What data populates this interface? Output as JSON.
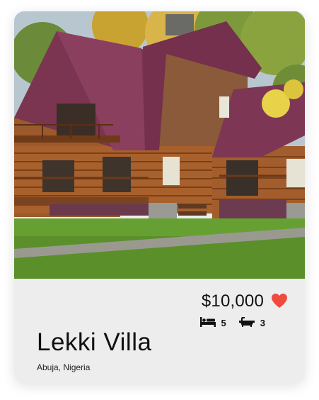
{
  "listing": {
    "price": "$10,000",
    "title": "Lekki Villa",
    "location": "Abuja, Nigeria",
    "bedrooms": "5",
    "bathrooms": "3"
  },
  "icons": {
    "favorite": "heart-icon",
    "bedrooms": "bed-icon",
    "bathrooms": "bathtub-icon"
  },
  "colors": {
    "heart": "#f04a3f",
    "card_background": "#ededed",
    "roof": "#7b3550"
  }
}
